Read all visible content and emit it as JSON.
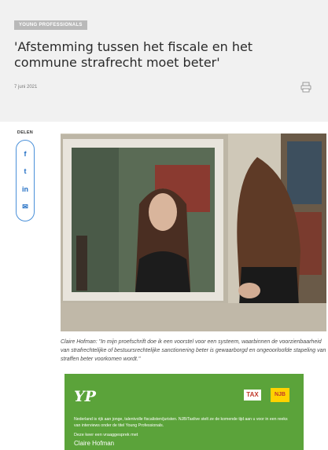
{
  "article": {
    "category": "YOUNG PROFESSIONALS",
    "title": "'Afstemming tussen het fiscale en het commune strafrecht moet beter'",
    "date": "7 juni 2021"
  },
  "share": {
    "label": "DELEN",
    "icons": [
      "facebook-icon",
      "twitter-icon",
      "linkedin-icon",
      "email-icon"
    ],
    "glyphs": [
      "f",
      "t",
      "in",
      "✉"
    ]
  },
  "photo": {
    "caption": "Claire Hofman: \"In mijn proefschrift doe ik een voorstel voor een systeem, waarbinnen de voorzienbaarheid van strafrechtelijke of bestuursrechtelijke sanctionering beter is gewaarborgd en ongeoorloofde stapeling van straffen beter voorkomen wordt.\""
  },
  "banner": {
    "logo": "YP",
    "tax_logo": "TAX",
    "njb_logo": "NJB",
    "intro": "Nederland is rijk aan jonge, talentvolle fiscalisten/juristen. NJB/Taxlive stelt ze de komende tijd aan u voor in een reeks van interviews onder de titel Young Professionals.",
    "now_label": "Deze keer een vraaggesprek met",
    "name": "Claire Hofman"
  },
  "colors": {
    "header_bg": "#f1f1f1",
    "share_blue": "#1f6dc4",
    "banner_green": "#5ba33a"
  }
}
